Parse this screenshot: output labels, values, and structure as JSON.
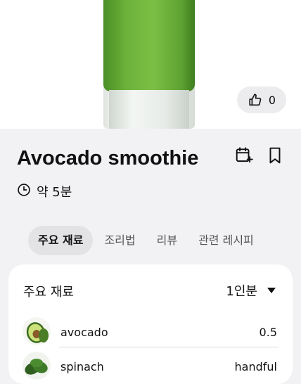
{
  "hero": {
    "like_count": "0"
  },
  "recipe": {
    "title": "Avocado smoothie",
    "time": "약 5분"
  },
  "tabs": [
    {
      "label": "주요 재료",
      "active": true
    },
    {
      "label": "조리법",
      "active": false
    },
    {
      "label": "리뷰",
      "active": false
    },
    {
      "label": "관련 레시피",
      "active": false
    }
  ],
  "ingredients": {
    "title": "주요 재료",
    "servings": "1인분",
    "items": [
      {
        "name": "avocado",
        "qty": "0.5",
        "icon": "avocado-icon"
      },
      {
        "name": "spinach",
        "qty": "handful",
        "icon": "spinach-icon"
      }
    ]
  },
  "colors": {
    "smoothie": "#6cb23a",
    "background": "#f2f2f4",
    "pill": "#ececee",
    "active_tab": "#e3e3e6"
  }
}
